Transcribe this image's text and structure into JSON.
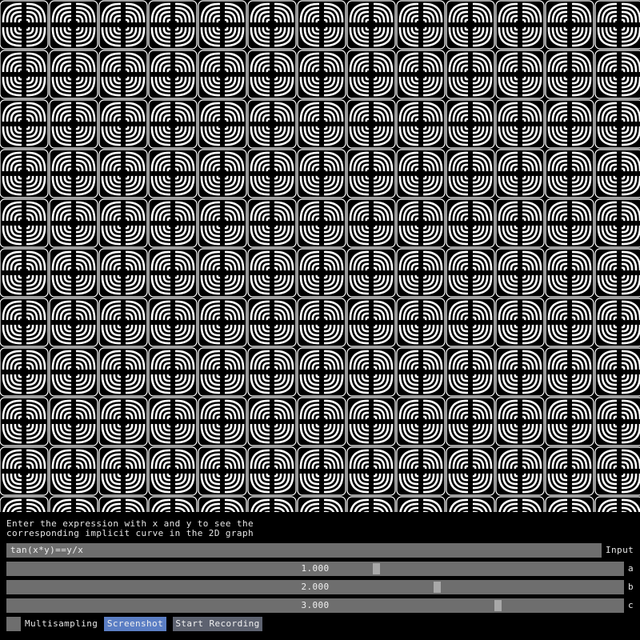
{
  "graph": {
    "expression_plotted": "tan(x*y)==y/x",
    "curve_color": "#ffffff",
    "background_color": "#000000"
  },
  "panel": {
    "help_line1": "Enter the expression with x and y to see the",
    "help_line2": "corresponding implicit curve in the 2D graph",
    "input": {
      "value": "tan(x*y)==y/x",
      "label": "Input"
    },
    "sliders": [
      {
        "name": "a",
        "display": "1.000",
        "value": 1.0,
        "min": -5,
        "max": 5
      },
      {
        "name": "b",
        "display": "2.000",
        "value": 2.0,
        "min": -5,
        "max": 5
      },
      {
        "name": "c",
        "display": "3.000",
        "value": 3.0,
        "min": -5,
        "max": 5
      }
    ],
    "multisampling": {
      "label": "Multisampling",
      "checked": false
    },
    "screenshot_label": "Screenshot",
    "record_label": "Start Recording",
    "accent_color": "#5b7ec4"
  }
}
